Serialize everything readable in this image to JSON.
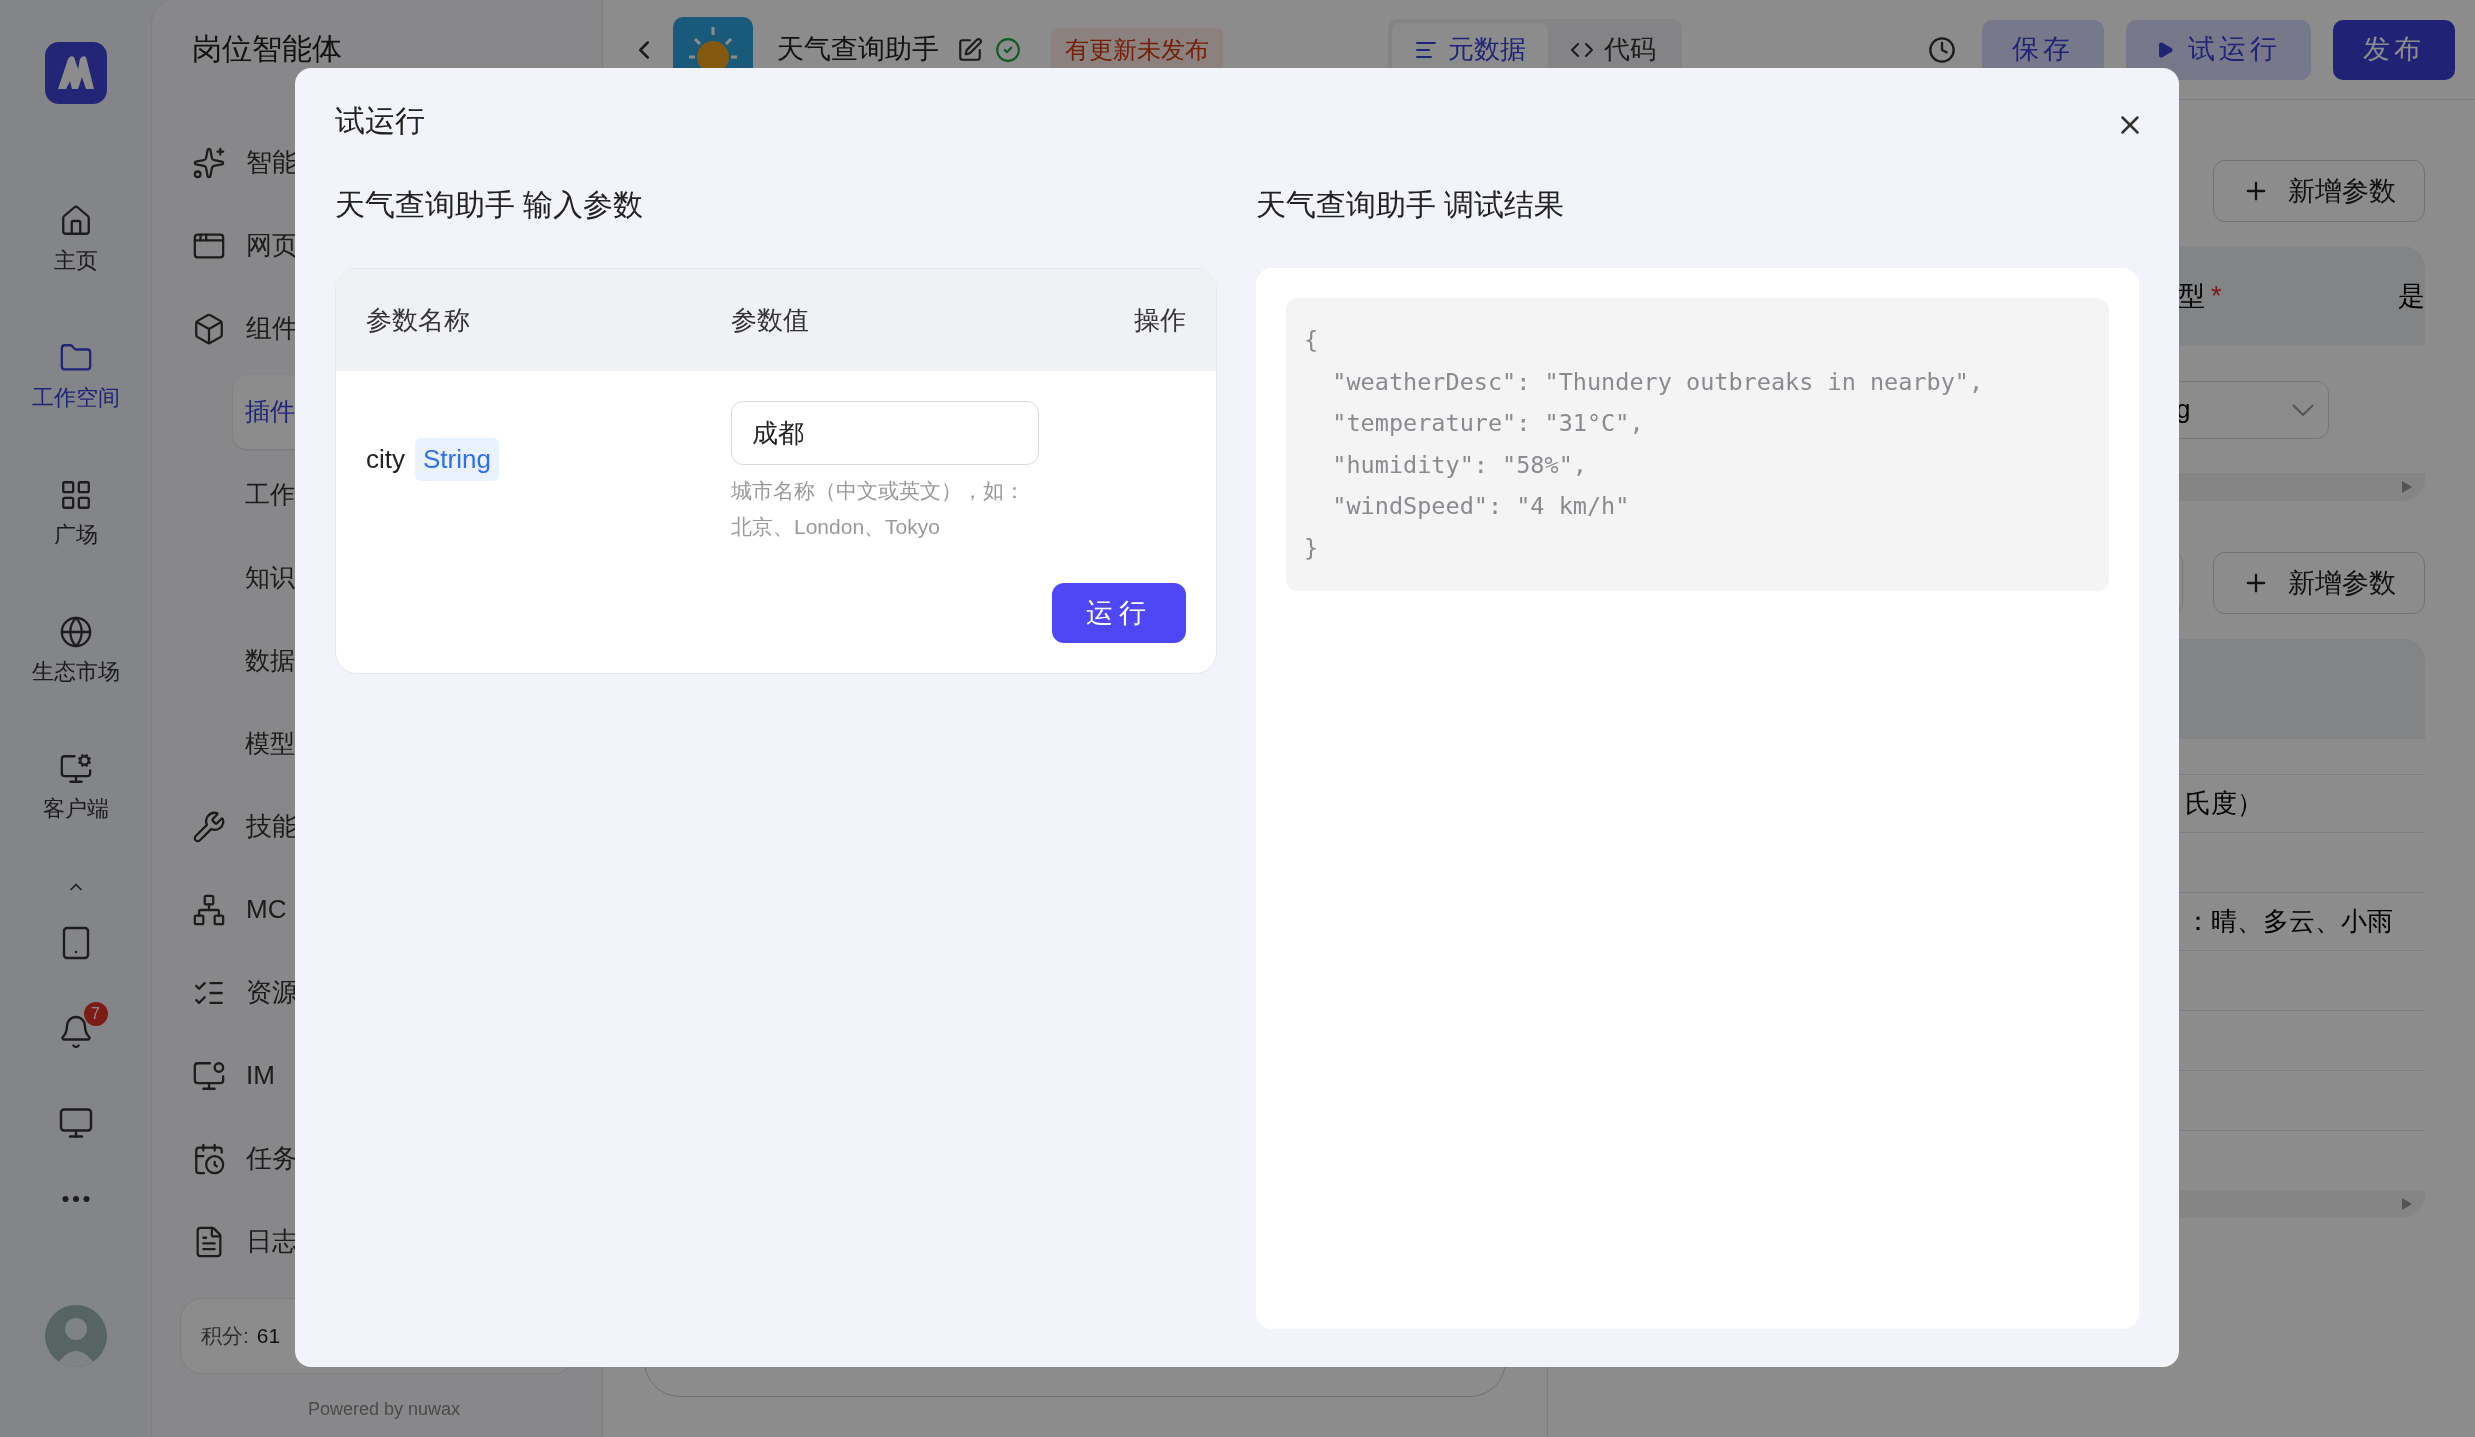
{
  "rail": {
    "items": [
      {
        "label": "主页",
        "selected": false,
        "kind": "home"
      },
      {
        "label": "工作空间",
        "selected": true,
        "kind": "folder"
      },
      {
        "label": "广场",
        "selected": false,
        "kind": "grid"
      },
      {
        "label": "生态市场",
        "selected": false,
        "kind": "globe"
      },
      {
        "label": "客户端",
        "selected": false,
        "kind": "client"
      }
    ],
    "notification_count": "7"
  },
  "sidebar": {
    "title": "岗位智能体",
    "items": [
      {
        "label": "智能",
        "kind": "sparkles",
        "selected": false
      },
      {
        "label": "网页",
        "kind": "window",
        "selected": false
      },
      {
        "label": "组件",
        "kind": "box",
        "selected": false
      },
      {
        "label": "插件",
        "kind": "sub",
        "selected": true
      },
      {
        "label": "工作",
        "kind": "sub",
        "selected": false
      },
      {
        "label": "知识",
        "kind": "sub",
        "selected": false
      },
      {
        "label": "数据",
        "kind": "sub",
        "selected": false
      },
      {
        "label": "模型",
        "kind": "sub",
        "selected": false
      },
      {
        "label": "技能",
        "kind": "tools",
        "selected": false
      },
      {
        "label": "MC",
        "kind": "network",
        "selected": false
      },
      {
        "label": "资源",
        "kind": "list",
        "selected": false
      },
      {
        "label": "IM",
        "kind": "monitor",
        "selected": false
      },
      {
        "label": "任务",
        "kind": "calendar",
        "selected": false
      },
      {
        "label": "日志",
        "kind": "file",
        "selected": false
      }
    ],
    "points_label": "积分:",
    "points_value": "61",
    "powered_by": "Powered by nuwax"
  },
  "header": {
    "title": "天气查询助手",
    "badge": "有更新未发布",
    "tabs": [
      {
        "label": "元数据",
        "selected": true,
        "kind": "list"
      },
      {
        "label": "代码",
        "selected": false,
        "kind": "code"
      }
    ],
    "buttons": [
      {
        "label": "保存",
        "kind": "secondary"
      },
      {
        "label": "试运行",
        "kind": "run"
      },
      {
        "label": "发布",
        "kind": "primary"
      }
    ]
  },
  "params_panel": {
    "sections": [
      {
        "add_button": "新增参数",
        "header_cells": [
          {
            "text": "型",
            "required": true
          },
          {
            "text": "是",
            "required": false
          }
        ],
        "required_mark": "*",
        "rows": [
          {
            "kind": "select",
            "cell": "g"
          }
        ]
      },
      {
        "add_button": "新增参数",
        "rows": [
          {
            "kind": "short"
          },
          {
            "kind": "text",
            "cell": "氏度）"
          },
          {
            "kind": "blank"
          },
          {
            "kind": "text",
            "cell": "：晴、多云、小雨"
          },
          {
            "kind": "blank"
          },
          {
            "kind": "blank"
          },
          {
            "kind": "blank"
          },
          {
            "kind": "blank"
          }
        ]
      }
    ]
  },
  "modal": {
    "title": "试运行",
    "input_heading": "天气查询助手 输入参数",
    "result_heading": "天气查询助手 调试结果",
    "columns": [
      "参数名称",
      "参数值",
      "操作"
    ],
    "params": [
      {
        "name": "city",
        "type": "String",
        "value": "成都",
        "hint": "城市名称（中文或英文），如：北京、London、Tokyo"
      }
    ],
    "run_button": "运行",
    "result_lines": [
      "{",
      "  \"weatherDesc\": \"Thundery outbreaks in nearby\",",
      "  \"temperature\": \"31°C\",",
      "  \"humidity\": \"58%\",",
      "  \"windSpeed\": \"4 km/h\"",
      "}"
    ]
  }
}
